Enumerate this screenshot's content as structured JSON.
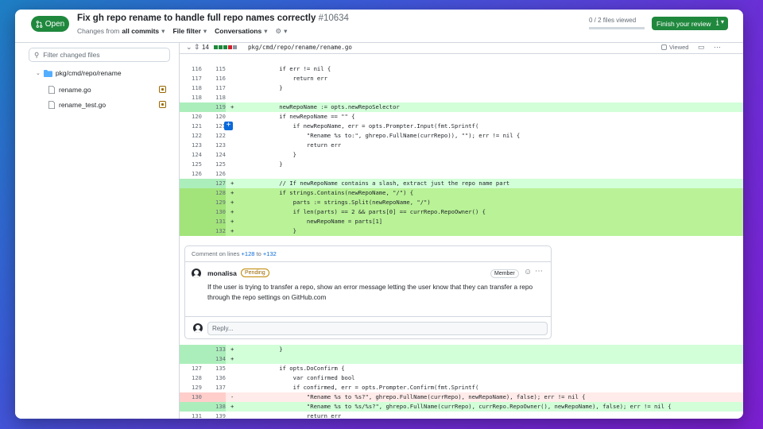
{
  "header": {
    "status": "Open",
    "title": "Fix gh repo rename to handle full repo names correctly",
    "number": "#10634",
    "changes_prefix": "Changes from",
    "changes_value": "all commits",
    "file_filter": "File filter",
    "conversations": "Conversations",
    "files_viewed": "0 / 2 files viewed",
    "finish_review": "Finish your review",
    "finish_count": "1"
  },
  "sidebar": {
    "filter_placeholder": "Filter changed files",
    "folder": "pkg/cmd/repo/rename",
    "files": [
      {
        "name": "rename.go"
      },
      {
        "name": "rename_test.go"
      }
    ]
  },
  "file_header": {
    "changes_count": "14",
    "path": "pkg/cmd/repo/rename/rename.go",
    "viewed_label": "Viewed"
  },
  "colors": {
    "accent_green": "#1f883d",
    "link_blue": "#0969da",
    "addition_bg": "#d2ffd8",
    "selected_bg": "#b9f297",
    "deletion_bg": "#ffebe9"
  },
  "diff_top": [
    {
      "old": "116",
      "new": "115",
      "sign": "",
      "code": "\tif err != nil {",
      "type": "ctx"
    },
    {
      "old": "117",
      "new": "116",
      "sign": "",
      "code": "\t\treturn err",
      "type": "ctx"
    },
    {
      "old": "118",
      "new": "117",
      "sign": "",
      "code": "\t}",
      "type": "ctx"
    },
    {
      "old": "118",
      "new": "118",
      "sign": "",
      "code": "",
      "type": "ctx"
    },
    {
      "old": "",
      "new": "119",
      "sign": "+",
      "code": "\tnewRepoName := opts.newRepoSelector",
      "type": "add"
    },
    {
      "old": "120",
      "new": "120",
      "sign": "",
      "code": "\tif newRepoName == \"\" {",
      "type": "ctx"
    },
    {
      "old": "121",
      "new": "121",
      "sign": "",
      "code": "\t\tif newRepoName, err = opts.Prompter.Input(fmt.Sprintf(",
      "type": "ctx"
    },
    {
      "old": "122",
      "new": "122",
      "sign": "",
      "code": "\t\t\t\"Rename %s to:\", ghrepo.FullName(currRepo)), \"\"); err != nil {",
      "type": "ctx"
    },
    {
      "old": "123",
      "new": "123",
      "sign": "",
      "code": "\t\t\treturn err",
      "type": "ctx"
    },
    {
      "old": "124",
      "new": "124",
      "sign": "",
      "code": "\t\t}",
      "type": "ctx"
    },
    {
      "old": "125",
      "new": "125",
      "sign": "",
      "code": "\t}",
      "type": "ctx"
    },
    {
      "old": "126",
      "new": "126",
      "sign": "",
      "code": "",
      "type": "ctx"
    },
    {
      "old": "",
      "new": "127",
      "sign": "+",
      "code": "\t// If newRepoName contains a slash, extract just the repo name part",
      "type": "add"
    },
    {
      "old": "",
      "new": "128",
      "sign": "+",
      "code": "\tif strings.Contains(newRepoName, \"/\") {",
      "type": "sel"
    },
    {
      "old": "",
      "new": "129",
      "sign": "+",
      "code": "\t\tparts := strings.Split(newRepoName, \"/\")",
      "type": "sel"
    },
    {
      "old": "",
      "new": "130",
      "sign": "+",
      "code": "\t\tif len(parts) == 2 && parts[0] == currRepo.RepoOwner() {",
      "type": "sel"
    },
    {
      "old": "",
      "new": "131",
      "sign": "+",
      "code": "\t\t\tnewRepoName = parts[1]",
      "type": "sel"
    },
    {
      "old": "",
      "new": "132",
      "sign": "+",
      "code": "\t\t}",
      "type": "sel"
    }
  ],
  "comment": {
    "on_lines_prefix": "Comment on lines",
    "line_start": "+128",
    "line_to": "to",
    "line_end": "+132",
    "author": "monalisa",
    "pending": "Pending",
    "role": "Member",
    "body": "If the user is trying to transfer a repo, show an error message letting the user know that they can transfer a repo through the repo settings on GitHub.com",
    "reply_placeholder": "Reply..."
  },
  "diff_bottom": [
    {
      "old": "",
      "new": "133",
      "sign": "+",
      "code": "\t}",
      "type": "add"
    },
    {
      "old": "",
      "new": "134",
      "sign": "+",
      "code": "",
      "type": "add"
    },
    {
      "old": "127",
      "new": "135",
      "sign": "",
      "code": "\tif opts.DoConfirm {",
      "type": "ctx"
    },
    {
      "old": "128",
      "new": "136",
      "sign": "",
      "code": "\t\tvar confirmed bool",
      "type": "ctx"
    },
    {
      "old": "129",
      "new": "137",
      "sign": "",
      "code": "\t\tif confirmed, err = opts.Prompter.Confirm(fmt.Sprintf(",
      "type": "ctx"
    },
    {
      "old": "130",
      "new": "",
      "sign": "-",
      "code": "\t\t\t\"Rename %s to %s?\", ghrepo.FullName(currRepo), newRepoName), false); err != nil {",
      "type": "del"
    },
    {
      "old": "",
      "new": "138",
      "sign": "+",
      "code": "\t\t\t\"Rename %s to %s/%s?\", ghrepo.FullName(currRepo), currRepo.RepoOwner(), newRepoName), false); err != nil {",
      "type": "add"
    },
    {
      "old": "131",
      "new": "139",
      "sign": "",
      "code": "\t\t\treturn err",
      "type": "ctx"
    },
    {
      "old": "132",
      "new": "140",
      "sign": "",
      "code": "\t\t}",
      "type": "ctx"
    }
  ]
}
